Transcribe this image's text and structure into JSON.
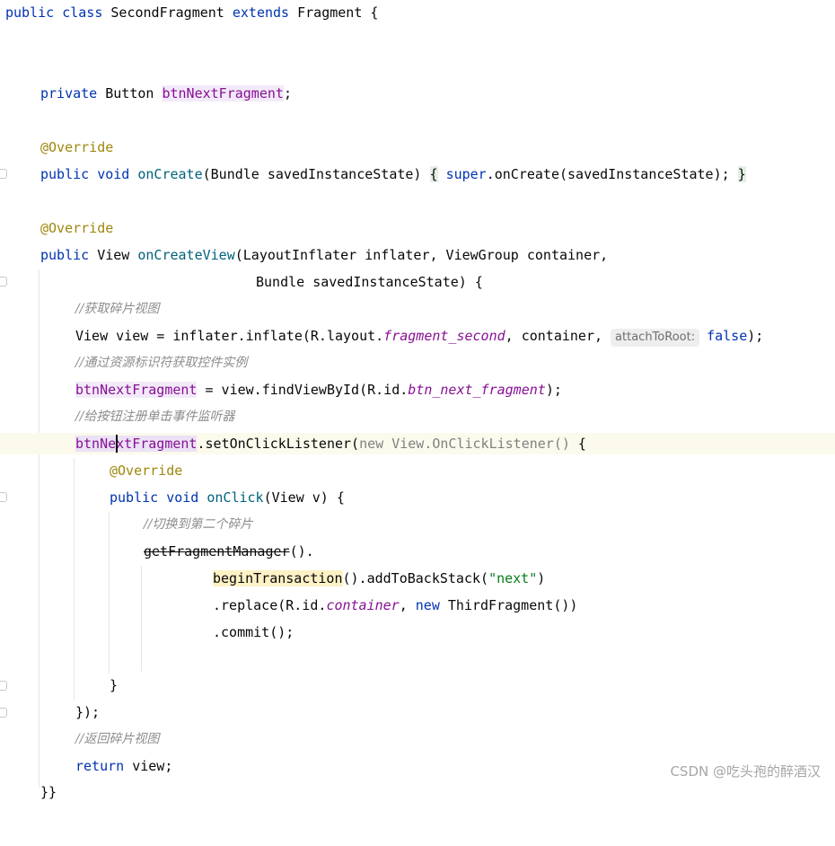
{
  "editor": {
    "tokens": {
      "public": "public",
      "class": "class",
      "extends": "extends",
      "private": "private",
      "void": "void",
      "new": "new",
      "super": "super",
      "return": "return",
      "false": "false",
      "override": "@Override",
      "class_name": "SecondFragment",
      "parent_class": "Fragment",
      "Button": "Button",
      "View": "View",
      "ThirdFragment": "ThirdFragment",
      "btnNextFragment": "btnNextFragment",
      "onCreate": "onCreate",
      "onCreateView": "onCreateView",
      "onClick": "onClick",
      "fragment_second": "fragment_second",
      "btn_next_fragment": "btn_next_fragment",
      "container_field": "container",
      "beginTransaction": "beginTransaction",
      "getFragmentManager": "getFragmentManager",
      "string_next": "\"next\"",
      "new_listener": "new View.OnClickListener()",
      "hint_attachToRoot": "attachToRoot:"
    },
    "comments": {
      "c1": "//获取碎片视图",
      "c2": "//通过资源标识符获取控件实例",
      "c3": "//给按钮注册单击事件监听器",
      "c4": "//切换到第二个碎片",
      "c5": "//返回碎片视图"
    },
    "text": {
      "t_open_brace": " {",
      "t_semicolon": ";",
      "t_bundle_param": "(Bundle savedInstanceState) ",
      "t_lbrace": "{",
      "t_super_call": ".onCreate(savedInstanceState); ",
      "t_rbrace": "}",
      "t_view_return": " View ",
      "t_inflater_params": "(LayoutInflater inflater, ViewGroup container,",
      "t_bundle_line": "Bundle savedInstanceState) {",
      "t_view_assign": "View view = inflater.inflate(R.layout.",
      "t_container_arg": ", container, ",
      "t_close_stmt": ");",
      "t_find_view": " = view.findViewById(R.id.",
      "t_set_listener": ".setOnClickListener(",
      "t_view_v": "(View v) {",
      "t_dot": "().",
      "t_back_stack": "().addToBackStack(",
      "t_close_paren": ")",
      "t_replace": ".replace(R.id.",
      "t_comma": ", ",
      "t_third_close": "())",
      "t_commit": ".commit();",
      "t_close_lambda": "});",
      "t_return_view": " view;",
      "t_final": "}}"
    }
  },
  "watermark": "CSDN @吃头孢的醉酒汉"
}
